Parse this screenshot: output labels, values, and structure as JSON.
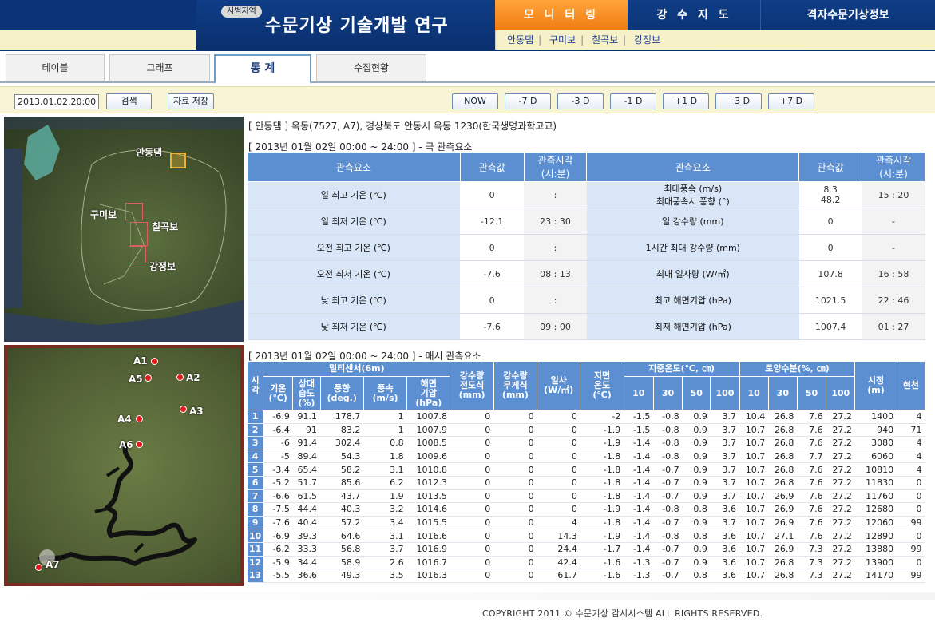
{
  "header": {
    "tag": "시범지역",
    "title": "수문기상 기술개발 연구",
    "tabs": [
      "모 니 터 링",
      "강 수 지 도",
      "격자수문기상정보"
    ],
    "sub_links": [
      "안동댐",
      "구미보",
      "칠곡보",
      "강정보"
    ]
  },
  "page_tabs": [
    "테이블",
    "그래프",
    "통 계",
    "수집현황"
  ],
  "toolbar": {
    "date": "2013.01.02.20:00",
    "search": "검색",
    "save": "자료 저장",
    "nav": [
      "NOW",
      "-7 D",
      "-3 D",
      "-1 D",
      "+1 D",
      "+3 D",
      "+7 D"
    ]
  },
  "map1": {
    "labels": [
      "안동댐",
      "구미보",
      "칠곡보",
      "강정보"
    ]
  },
  "map2": {
    "labels": [
      "A1",
      "A2",
      "A5",
      "A3",
      "A4",
      "A6",
      "A7"
    ]
  },
  "station_info": "[ 안동댐 ] 옥동(7527, A7), 경상북도 안동시 옥동 1230(한국생명과학고교)",
  "summary": {
    "period": "[ 2013년 01월 02일 00:00 ~ 24:00 ] - 극 관측요소",
    "headers": [
      "관측요소",
      "관측값",
      "관측시각\n(시:분)",
      "관측요소",
      "관측값",
      "관측시각\n(시:분)"
    ],
    "rows": [
      [
        "일 최고 기온 (℃)",
        "0",
        ":",
        "최대풍속 (m/s)\n최대풍속시 풍향 (°)",
        "8.3\n48.2",
        "15 : 20"
      ],
      [
        "일 최저 기온 (℃)",
        "-12.1",
        "23 : 30",
        "일 강수량 (mm)",
        "0",
        "-"
      ],
      [
        "오전 최고 기온 (℃)",
        "0",
        ":",
        "1시간 최대 강수량 (mm)",
        "0",
        "-"
      ],
      [
        "오전 최저 기온 (℃)",
        "-7.6",
        "08 : 13",
        "최대 일사량 (W/㎡)",
        "107.8",
        "16 : 58"
      ],
      [
        "낮 최고 기온 (℃)",
        "0",
        ":",
        "최고 해면기압 (hPa)",
        "1021.5",
        "22 : 46"
      ],
      [
        "낮 최저 기온 (℃)",
        "-7.6",
        "09 : 00",
        "최저 해면기압 (hPa)",
        "1007.4",
        "01 : 27"
      ]
    ]
  },
  "hourly": {
    "period": "[ 2013년 01월 02일 00:00 ~ 24:00 ] - 매시 관측요소",
    "group_headers": {
      "hour": "시각",
      "multi": "멀티센서(6m)",
      "rain_tip": "강수량\n전도식\n(mm)",
      "rain_wt": "강수량\n무게식\n(mm)",
      "solar": "일사\n(W/㎡)",
      "ground": "지면\n온도\n(℃)",
      "soil_temp": "지중온도(℃, ㎝)",
      "soil_moist": "토양수분(%, ㎝)",
      "vis": "시정\n(m)",
      "weather": "현천"
    },
    "sub_headers": [
      "기온\n(℃)",
      "상대\n습도\n(%)",
      "풍향\n(deg.)",
      "풍속\n(m/s)",
      "해면\n기압\n(hPa)",
      "10",
      "30",
      "50",
      "100",
      "10",
      "30",
      "50",
      "100"
    ],
    "rows": [
      [
        "1",
        "-6.9",
        "91.1",
        "178.7",
        "1",
        "1007.8",
        "0",
        "0",
        "0",
        "-2",
        "-1.5",
        "-0.8",
        "0.9",
        "3.7",
        "10.4",
        "26.8",
        "7.6",
        "27.2",
        "1400",
        "4"
      ],
      [
        "2",
        "-6.4",
        "91",
        "83.2",
        "1",
        "1007.9",
        "0",
        "0",
        "0",
        "-1.9",
        "-1.5",
        "-0.8",
        "0.9",
        "3.7",
        "10.7",
        "26.8",
        "7.6",
        "27.2",
        "940",
        "71"
      ],
      [
        "3",
        "-6",
        "91.4",
        "302.4",
        "0.8",
        "1008.5",
        "0",
        "0",
        "0",
        "-1.9",
        "-1.4",
        "-0.8",
        "0.9",
        "3.7",
        "10.7",
        "26.8",
        "7.6",
        "27.2",
        "3080",
        "4"
      ],
      [
        "4",
        "-5",
        "89.4",
        "54.3",
        "1.8",
        "1009.6",
        "0",
        "0",
        "0",
        "-1.8",
        "-1.4",
        "-0.8",
        "0.9",
        "3.7",
        "10.7",
        "26.8",
        "7.7",
        "27.2",
        "6060",
        "4"
      ],
      [
        "5",
        "-3.4",
        "65.4",
        "58.2",
        "3.1",
        "1010.8",
        "0",
        "0",
        "0",
        "-1.8",
        "-1.4",
        "-0.7",
        "0.9",
        "3.7",
        "10.7",
        "26.8",
        "7.6",
        "27.2",
        "10810",
        "4"
      ],
      [
        "6",
        "-5.2",
        "51.7",
        "85.6",
        "6.2",
        "1012.3",
        "0",
        "0",
        "0",
        "-1.8",
        "-1.4",
        "-0.7",
        "0.9",
        "3.7",
        "10.7",
        "26.8",
        "7.6",
        "27.2",
        "11830",
        "0"
      ],
      [
        "7",
        "-6.6",
        "61.5",
        "43.7",
        "1.9",
        "1013.5",
        "0",
        "0",
        "0",
        "-1.8",
        "-1.4",
        "-0.7",
        "0.9",
        "3.7",
        "10.7",
        "26.9",
        "7.6",
        "27.2",
        "11760",
        "0"
      ],
      [
        "8",
        "-7.5",
        "44.4",
        "40.3",
        "3.2",
        "1014.6",
        "0",
        "0",
        "0",
        "-1.9",
        "-1.4",
        "-0.8",
        "0.8",
        "3.6",
        "10.7",
        "26.9",
        "7.6",
        "27.2",
        "12680",
        "0"
      ],
      [
        "9",
        "-7.6",
        "40.4",
        "57.2",
        "3.4",
        "1015.5",
        "0",
        "0",
        "4",
        "-1.8",
        "-1.4",
        "-0.7",
        "0.9",
        "3.7",
        "10.7",
        "26.9",
        "7.6",
        "27.2",
        "12060",
        "99"
      ],
      [
        "10",
        "-6.9",
        "39.3",
        "64.6",
        "3.1",
        "1016.6",
        "0",
        "0",
        "14.3",
        "-1.9",
        "-1.4",
        "-0.8",
        "0.8",
        "3.6",
        "10.7",
        "27.1",
        "7.6",
        "27.2",
        "12890",
        "0"
      ],
      [
        "11",
        "-6.2",
        "33.3",
        "56.8",
        "3.7",
        "1016.9",
        "0",
        "0",
        "24.4",
        "-1.7",
        "-1.4",
        "-0.7",
        "0.9",
        "3.6",
        "10.7",
        "26.9",
        "7.3",
        "27.2",
        "13880",
        "99"
      ],
      [
        "12",
        "-5.9",
        "34.4",
        "58.9",
        "2.6",
        "1016.7",
        "0",
        "0",
        "42.4",
        "-1.6",
        "-1.3",
        "-0.7",
        "0.9",
        "3.6",
        "10.7",
        "26.8",
        "7.3",
        "27.2",
        "13900",
        "0"
      ],
      [
        "13",
        "-5.5",
        "36.6",
        "49.3",
        "3.5",
        "1016.3",
        "0",
        "0",
        "61.7",
        "-1.6",
        "-1.3",
        "-0.7",
        "0.8",
        "3.6",
        "10.7",
        "26.8",
        "7.3",
        "27.2",
        "14170",
        "99"
      ]
    ]
  },
  "footer": "COPYRIGHT 2011 © 수문기상 감시시스템 ALL RIGHTS RESERVED."
}
